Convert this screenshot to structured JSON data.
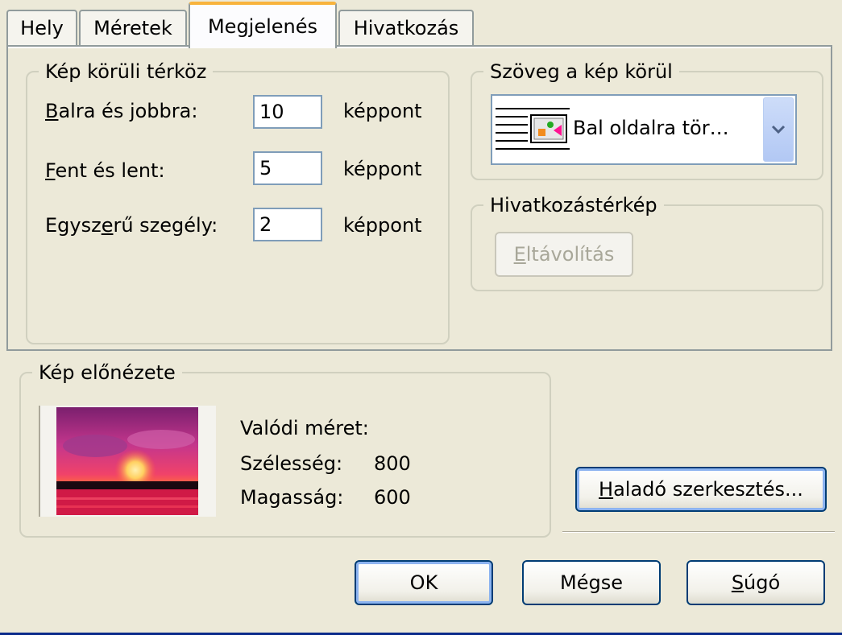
{
  "tabs": [
    "Hely",
    "Méretek",
    "Megjelenés",
    "Hivatkozás"
  ],
  "active_tab": "Megjelenés",
  "spacing": {
    "title": "Kép körüli térköz",
    "rows": [
      {
        "label_accel": "B",
        "label_rest": "alra és jobbra:",
        "value": "10",
        "unit": "képpont"
      },
      {
        "label_accel": "F",
        "label_rest": "ent és lent:",
        "value": "5",
        "unit": "képpont"
      },
      {
        "label_pre": "Egysz",
        "label_accel": "e",
        "label_post": "rű szegély:",
        "value": "2",
        "unit": "képpont"
      }
    ]
  },
  "wrap": {
    "title": "Szöveg a kép körül",
    "selected": "Bal oldalra tör…"
  },
  "imagemap": {
    "title": "Hivatkozástérkép",
    "remove_accel": "E",
    "remove_rest": "ltávolítás"
  },
  "preview": {
    "title": "Kép előnézete",
    "actual_size_label": "Valódi méret:",
    "width_label": "Szélesség:",
    "width_value": "800",
    "height_label": "Magasság:",
    "height_value": "600"
  },
  "advanced_edit": {
    "accel": "H",
    "rest": "aladó szerkesztés..."
  },
  "buttons": {
    "ok": "OK",
    "cancel": "Mégse",
    "help_accel": "S",
    "help_rest": "úgó"
  }
}
